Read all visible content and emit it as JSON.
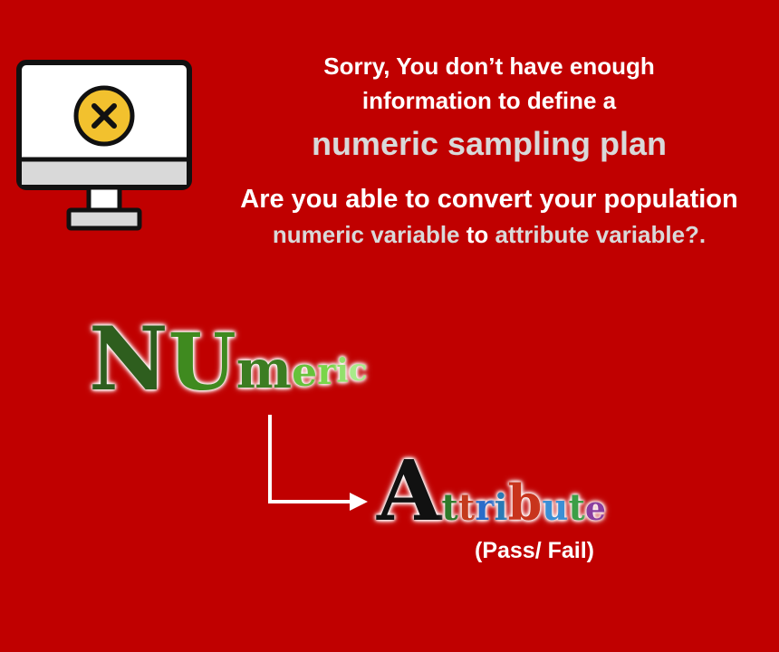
{
  "message": {
    "line1": "Sorry, You don’t have enough",
    "line2": "information to define a",
    "line3": "numeric sampling plan",
    "line4": "Are  you able to convert your population",
    "line5_part1": "numeric variable",
    "line5_part2": " to ",
    "line5_part3": "attribute variable?."
  },
  "numeric_word": {
    "letters": [
      {
        "char": "N",
        "color": "#2e5e1e"
      },
      {
        "char": "U",
        "color": "#3f8a1f"
      },
      {
        "char": "m",
        "color": "#3c7d22"
      },
      {
        "char": "e",
        "color": "#66c23b"
      },
      {
        "char": "r",
        "color": "#7ad64a"
      },
      {
        "char": "i",
        "color": "#92e06b"
      },
      {
        "char": "c",
        "color": "#a8eb8a"
      }
    ]
  },
  "attribute_word": {
    "letters": [
      {
        "char": "A",
        "color": "#111111"
      },
      {
        "char": "t",
        "color": "#2f7a2a"
      },
      {
        "char": "t",
        "color": "#c43a1d"
      },
      {
        "char": "r",
        "color": "#2a6cc9"
      },
      {
        "char": "i",
        "color": "#2a7ab5"
      },
      {
        "char": "b",
        "color": "#c8341c"
      },
      {
        "char": "u",
        "color": "#3a8fd6"
      },
      {
        "char": "t",
        "color": "#3c9e46"
      },
      {
        "char": "e",
        "color": "#8a3fa0"
      }
    ]
  },
  "pass_fail": "(Pass/ Fail)",
  "icons": {
    "monitor": "monitor-error-icon",
    "arrow": "arrow-right-icon"
  },
  "colors": {
    "background": "#c00000",
    "highlight_text": "#d9d9d9",
    "error_circle": "#f2c12e"
  }
}
